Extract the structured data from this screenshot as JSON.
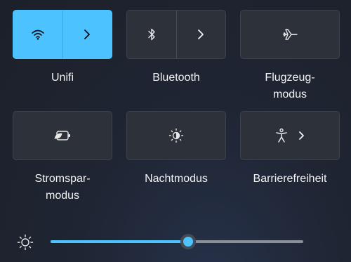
{
  "quick_settings": {
    "tiles": [
      {
        "label_lines": [
          "Unifi"
        ],
        "icon": "wifi-icon",
        "active": true
      },
      {
        "label_lines": [
          "Bluetooth"
        ],
        "icon": "bluetooth-icon",
        "active": false
      },
      {
        "label_lines": [
          "Flugzeug-",
          "modus"
        ],
        "icon": "airplane-icon",
        "active": false
      },
      {
        "label_lines": [
          "Stromspar-",
          "modus"
        ],
        "icon": "battery-saver-icon",
        "active": false
      },
      {
        "label_lines": [
          "Nachtmodus"
        ],
        "icon": "night-light-icon",
        "active": false
      },
      {
        "label_lines": [
          "Barrierefreiheit"
        ],
        "icon": "accessibility-icon",
        "active": false
      }
    ]
  },
  "brightness": {
    "icon": "sun-icon",
    "level": 0.545
  },
  "colors": {
    "accent": "#4cc2ff",
    "tile_bg": "#2c313a",
    "tile_border": "#3d434d",
    "track": "#8a8f98"
  }
}
